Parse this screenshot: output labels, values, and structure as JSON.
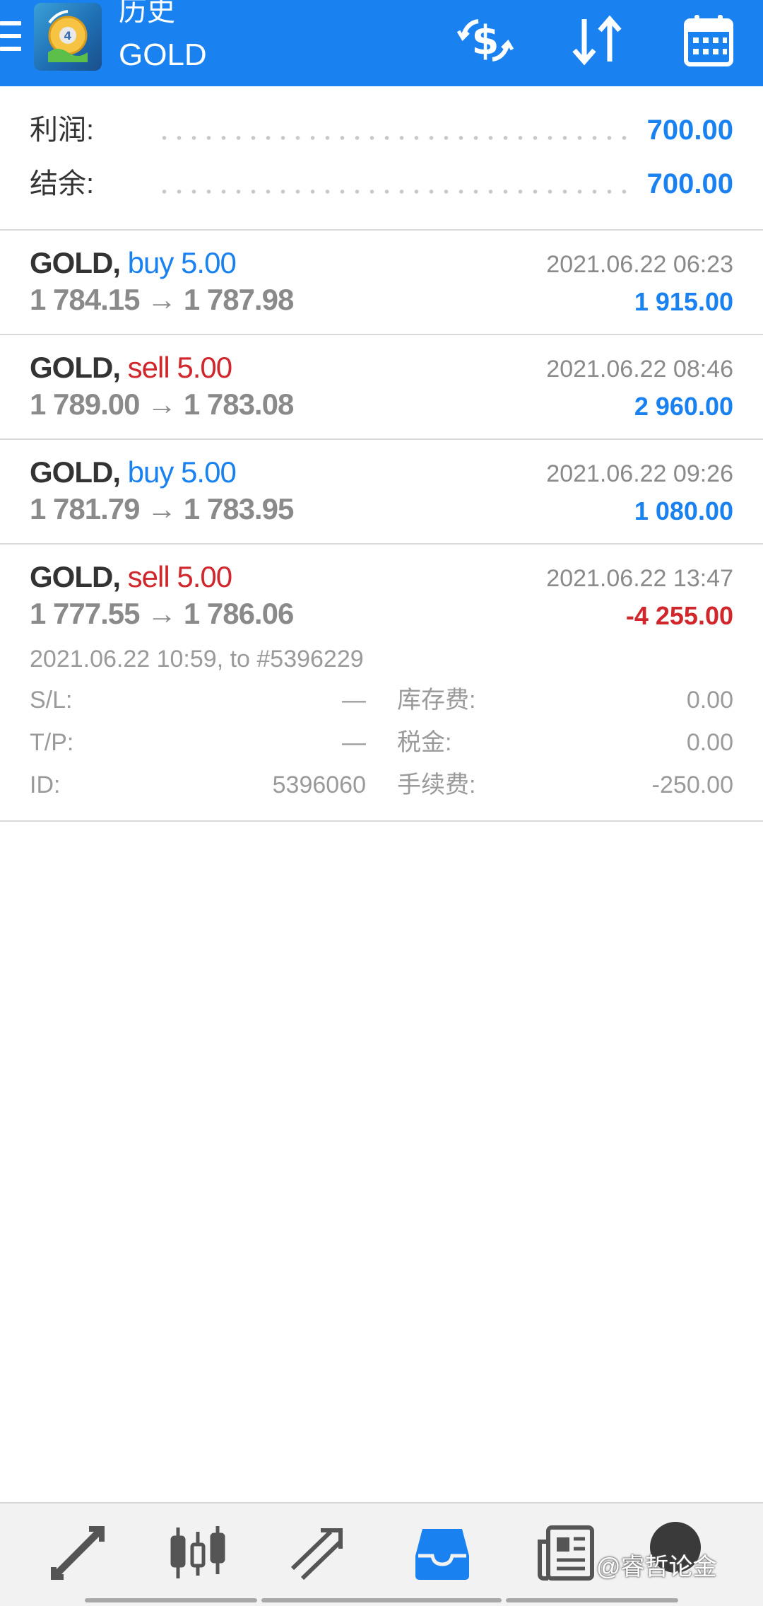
{
  "header": {
    "subtitle": "历史",
    "title": "GOLD"
  },
  "summary": {
    "profit_label": "利润:",
    "profit_value": "700.00",
    "balance_label": "结余:",
    "balance_value": "700.00"
  },
  "deals": [
    {
      "symbol": "GOLD,",
      "side": "buy 5.00",
      "side_type": "buy",
      "prices": "1 784.15 → 1 787.98",
      "time": "2021.06.22 06:23",
      "profit": "1 915.00"
    },
    {
      "symbol": "GOLD,",
      "side": "sell 5.00",
      "side_type": "sell",
      "prices": "1 789.00 → 1 783.08",
      "time": "2021.06.22 08:46",
      "profit": "2 960.00"
    },
    {
      "symbol": "GOLD,",
      "side": "buy 5.00",
      "side_type": "buy",
      "prices": "1 781.79 → 1 783.95",
      "time": "2021.06.22 09:26",
      "profit": "1 080.00"
    },
    {
      "symbol": "GOLD,",
      "side": "sell 5.00",
      "side_type": "sell",
      "prices": "1 777.55 → 1 786.06",
      "time": "2021.06.22 13:47",
      "profit": "-4 255.00",
      "details": {
        "open_info": "2021.06.22 10:59, to #5396229",
        "sl_label": "S/L:",
        "sl_value": "—",
        "tp_label": "T/P:",
        "tp_value": "—",
        "id_label": "ID:",
        "id_value": "5396060",
        "swap_label": "库存费:",
        "swap_value": "0.00",
        "tax_label": "税金:",
        "tax_value": "0.00",
        "commission_label": "手续费:",
        "commission_value": "-250.00"
      }
    }
  ],
  "bottom_nav": {
    "active": "history",
    "items": [
      "quotes-icon",
      "chart-icon",
      "trade-icon",
      "history-icon",
      "news-icon"
    ]
  },
  "watermark": "@睿哲论金",
  "colors": {
    "accent": "#1a82f0",
    "sell": "#d0262c",
    "muted": "#8a8a8a"
  }
}
